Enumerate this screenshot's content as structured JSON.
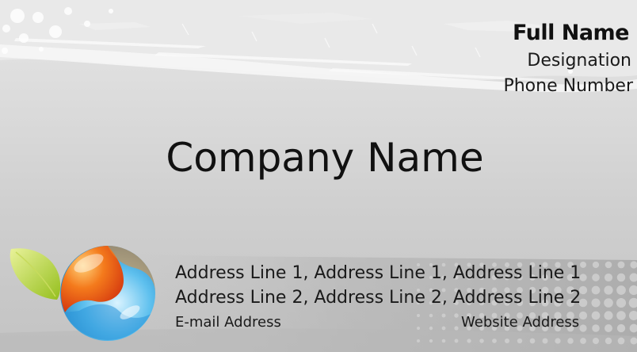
{
  "card": {
    "full_name": "Full Name",
    "designation": "Designation",
    "phone": "Phone Number",
    "company": "Company Name",
    "address_line_1": "Address Line 1,  Address Line 1,  Address Line 1",
    "address_line_2": "Address Line 2,  Address Line 2,  Address Line 2",
    "email": "E-mail Address",
    "website": "Website Address"
  },
  "logo": {
    "icon": "yin-yang-sphere-icon",
    "leaf_icon": "leaf-icon",
    "colors": {
      "orange": "#f06a1a",
      "blue": "#3fa9e0",
      "leaf": "#a8cc2a"
    }
  },
  "colors": {
    "background": "#d9d9d9",
    "text": "#111111",
    "grunge": "#f7f7f7",
    "halftone": "#b5b5b5"
  }
}
